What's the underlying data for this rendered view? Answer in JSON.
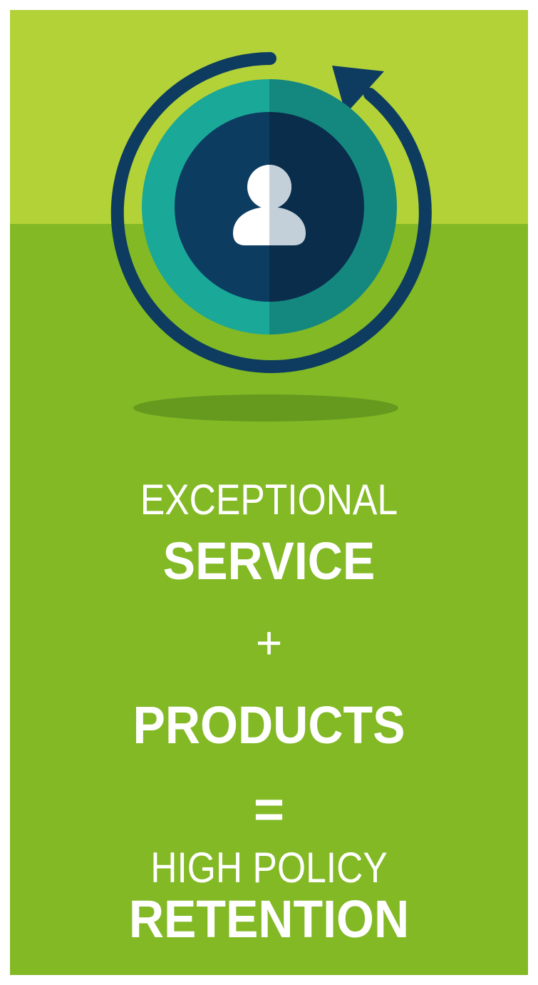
{
  "colors": {
    "top_band": "#b2d238",
    "main_band": "#82b925",
    "shadow": "#659a1f",
    "ring_dark": "#0d3c60",
    "teal_left": "#1aa898",
    "teal_right": "#14887f",
    "center_left": "#0d3c61",
    "center_right": "#0a2d4c",
    "person_left": "#ffffff",
    "person_right": "#c4d0d9",
    "text": "#ffffff"
  },
  "icons": {
    "refresh": "circular-arrow-icon",
    "user": "person-icon"
  },
  "headline": {
    "line1_light": "EXCEPTIONAL",
    "line1_bold": "SERVICE",
    "plus": "+",
    "line2_bold": "PRODUCTS",
    "equals": "=",
    "line3_light": "HIGH POLICY",
    "line3_bold": "RETENTION"
  }
}
